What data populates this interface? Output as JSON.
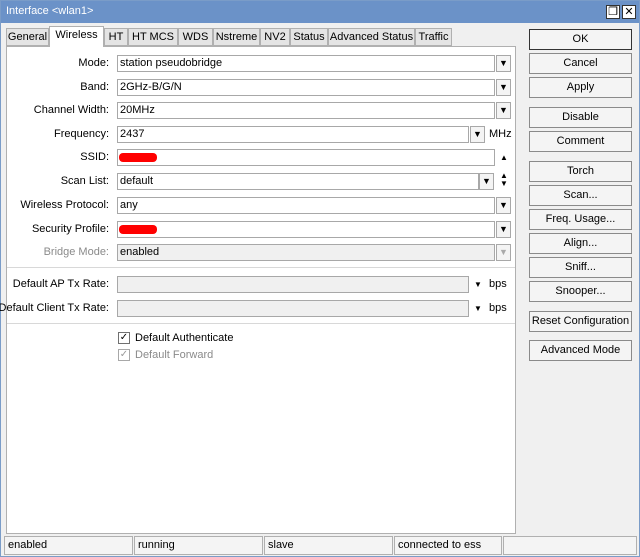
{
  "window": {
    "title": "Interface <wlan1>",
    "restore_glyph": "❐",
    "close_glyph": "✕"
  },
  "tabs": [
    "General",
    "Wireless",
    "HT",
    "HT MCS",
    "WDS",
    "Nstreme",
    "NV2",
    "Status",
    "Advanced Status",
    "Traffic"
  ],
  "active_tab": "Wireless",
  "form": {
    "mode": {
      "label": "Mode:",
      "value": "station pseudobridge"
    },
    "band": {
      "label": "Band:",
      "value": "2GHz-B/G/N"
    },
    "channel_width": {
      "label": "Channel Width:",
      "value": "20MHz"
    },
    "frequency": {
      "label": "Frequency:",
      "value": "2437",
      "unit": "MHz"
    },
    "ssid": {
      "label": "SSID:",
      "value": ""
    },
    "scan_list": {
      "label": "Scan List:",
      "value": "default"
    },
    "wireless_protocol": {
      "label": "Wireless Protocol:",
      "value": "any"
    },
    "security_profile": {
      "label": "Security Profile:",
      "value": ""
    },
    "bridge_mode": {
      "label": "Bridge Mode:",
      "value": "enabled"
    },
    "default_ap_tx_rate": {
      "label": "Default AP Tx Rate:",
      "value": "",
      "unit": "bps"
    },
    "default_client_tx_rate": {
      "label": "Default Client Tx Rate:",
      "value": "",
      "unit": "bps"
    },
    "default_authenticate": {
      "label": "Default Authenticate",
      "checked": true
    },
    "default_forward": {
      "label": "Default Forward",
      "checked": true
    }
  },
  "buttons": {
    "ok": "OK",
    "cancel": "Cancel",
    "apply": "Apply",
    "disable": "Disable",
    "comment": "Comment",
    "torch": "Torch",
    "scan": "Scan...",
    "freq_usage": "Freq. Usage...",
    "align": "Align...",
    "sniff": "Sniff...",
    "snooper": "Snooper...",
    "reset_configuration": "Reset Configuration",
    "advanced_mode": "Advanced Mode"
  },
  "status": [
    "enabled",
    "running",
    "slave",
    "connected to ess",
    ""
  ],
  "glyphs": {
    "dropdown": "▼",
    "up": "▲",
    "down": "▼",
    "check": "✓"
  },
  "colors": {
    "titlebar": "#6b92c8",
    "redaction": "#ff0000"
  }
}
